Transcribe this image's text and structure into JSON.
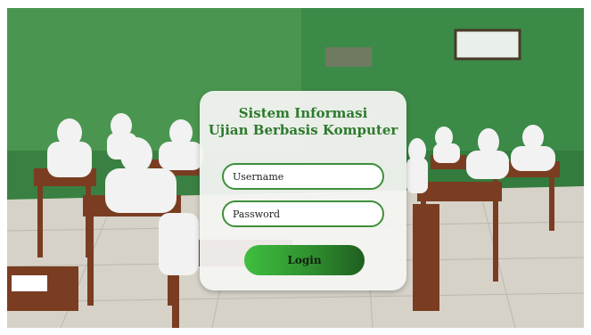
{
  "login": {
    "title_line1": "Sistem Informasi",
    "title_line2": "Ujian Berbasis Komputer",
    "username_placeholder": "Username",
    "password_placeholder": "Password",
    "login_label": "Login"
  },
  "colors": {
    "accent": "#2f7a2f",
    "button_start": "#3fbf3f",
    "button_end": "#1f5f1f",
    "field_border": "#3f8f3a"
  }
}
